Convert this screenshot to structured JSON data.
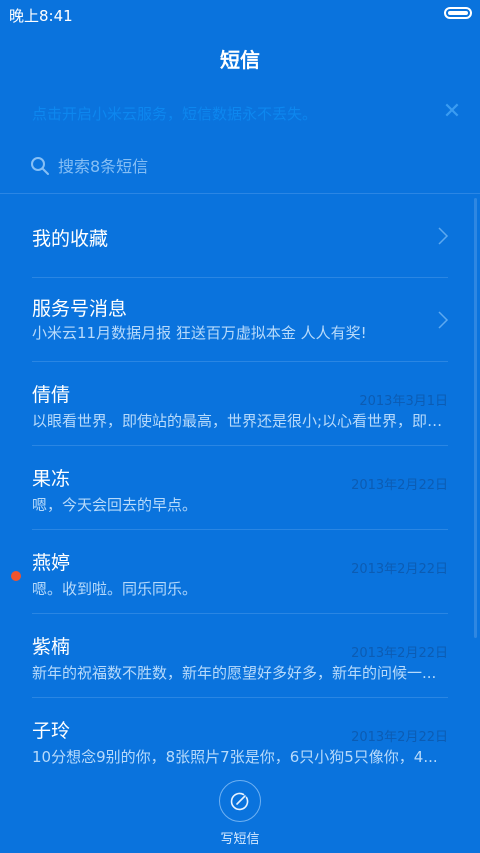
{
  "status_bar": {
    "time": "晚上8:41"
  },
  "header": {
    "title": "短信"
  },
  "banner": {
    "text": "点击开启小米云服务，短信数据永不丢失。"
  },
  "search": {
    "placeholder": "搜索8条短信"
  },
  "favorites": {
    "label": "我的收藏"
  },
  "service": {
    "name": "服务号消息",
    "preview": "小米云11月数据月报 狂送百万虚拟本金 人人有奖!"
  },
  "conversations": [
    {
      "name": "倩倩",
      "date": "2013年3月1日",
      "preview": "以眼看世界，即使站的最高，世界还是很小;以心看世界，即使..."
    },
    {
      "name": "果冻",
      "date": "2013年2月22日",
      "preview": "嗯，今天会回去的早点。"
    },
    {
      "name": "燕婷",
      "date": "2013年2月22日",
      "preview": "嗯。收到啦。同乐同乐。",
      "unread": true
    },
    {
      "name": "紫楠",
      "date": "2013年2月22日",
      "preview": "新年的祝福数不胜数，新年的愿望好多好多，新年的问候一..."
    },
    {
      "name": "子玲",
      "date": "2013年2月22日",
      "preview": "10分想念9别的你，8张照片7张是你，6只小狗5只像你，4..."
    }
  ],
  "compose": {
    "label": "写短信"
  },
  "colors": {
    "background": "#0a73dd",
    "unread_dot": "#f2542d",
    "date": "#0c5cb3"
  }
}
